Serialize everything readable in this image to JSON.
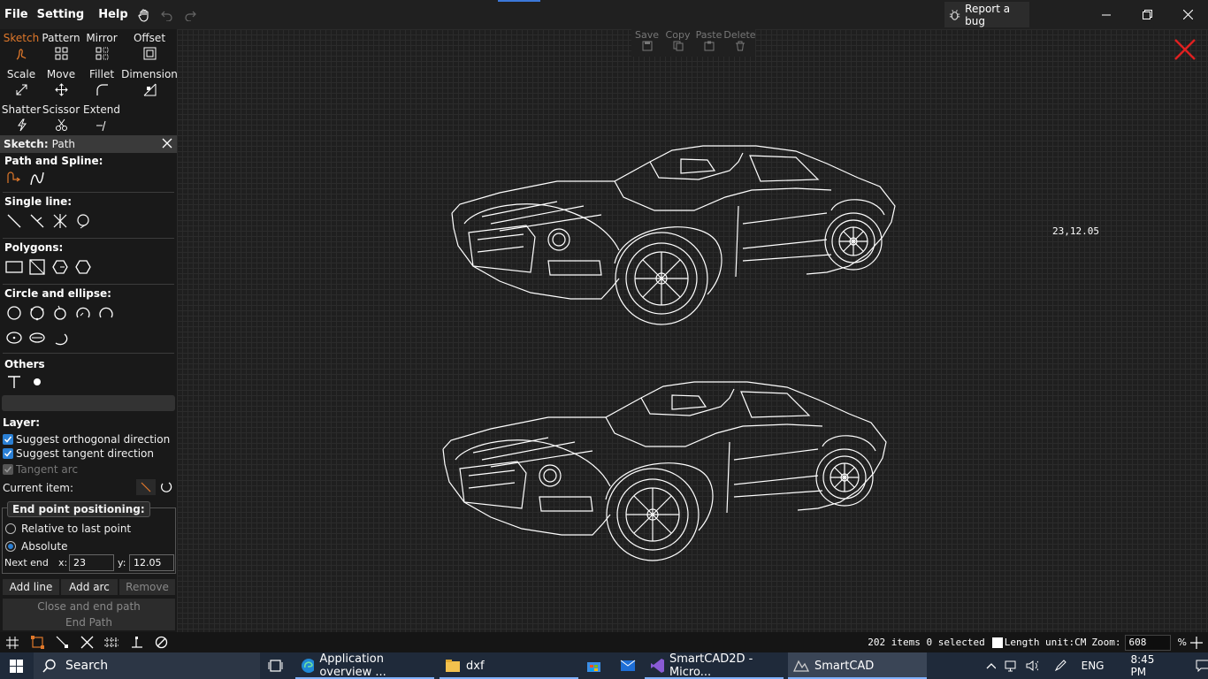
{
  "menu": {
    "file": "File",
    "setting": "Setting",
    "help": "Help"
  },
  "report_bug": "Report a bug",
  "tools": [
    {
      "label": "Sketch",
      "icon": "sketch-icon",
      "active": true
    },
    {
      "label": "Pattern",
      "icon": "pattern-icon"
    },
    {
      "label": "Mirror",
      "icon": "mirror-icon"
    },
    {
      "label": "Offset",
      "icon": "offset-icon"
    },
    {
      "label": "Scale",
      "icon": "scale-icon"
    },
    {
      "label": "Move",
      "icon": "move-icon"
    },
    {
      "label": "Fillet",
      "icon": "fillet-icon"
    },
    {
      "label": "Dimension",
      "icon": "dimension-icon"
    },
    {
      "label": "Shatter",
      "icon": "shatter-icon"
    },
    {
      "label": "Scissor",
      "icon": "scissor-icon"
    },
    {
      "label": "Extend",
      "icon": "extend-icon"
    }
  ],
  "sketch": {
    "title": "Sketch:",
    "mode": "Path"
  },
  "sections": {
    "path_spline": "Path and Spline:",
    "single_line": "Single line:",
    "polygons": "Polygons:",
    "circle_ellipse": "Circle and ellipse:",
    "others": "Others"
  },
  "layer_label": "Layer:",
  "options": {
    "orthogonal": "Suggest orthogonal direction",
    "tangent_dir": "Suggest tangent direction",
    "tangent_arc": "Tangent arc"
  },
  "current_item": "Current item:",
  "endpoint": {
    "title": "End point positioning:",
    "relative": "Relative to last point",
    "absolute": "Absolute",
    "next_end": "Next end",
    "x_label": "x:",
    "x_value": "23",
    "y_label": "y:",
    "y_value": "12.05"
  },
  "buttons": {
    "add_line": "Add line",
    "add_arc": "Add arc",
    "remove": "Remove",
    "close_end": "Close and end path",
    "end_path": "End Path"
  },
  "clipboard": {
    "save": "Save",
    "copy": "Copy",
    "paste": "Paste",
    "delete": "Delete"
  },
  "cursor_coord": "23,12.05",
  "status": {
    "items": "202 items 0 selected",
    "length_unit": "Length unit:CM",
    "zoom_label": "Zoom:",
    "zoom_value": "608",
    "percent": "%"
  },
  "taskbar": {
    "search": "Search",
    "apps": [
      {
        "label": "Application overview ..."
      },
      {
        "label": "dxf"
      },
      {
        "label": "SmartCAD2D - Micro..."
      },
      {
        "label": "SmartCAD"
      }
    ],
    "lang": "ENG",
    "time": "8:45 PM"
  },
  "colors": {
    "accent": "#e0782a",
    "check": "#2a7fd4",
    "close": "#e02020"
  }
}
